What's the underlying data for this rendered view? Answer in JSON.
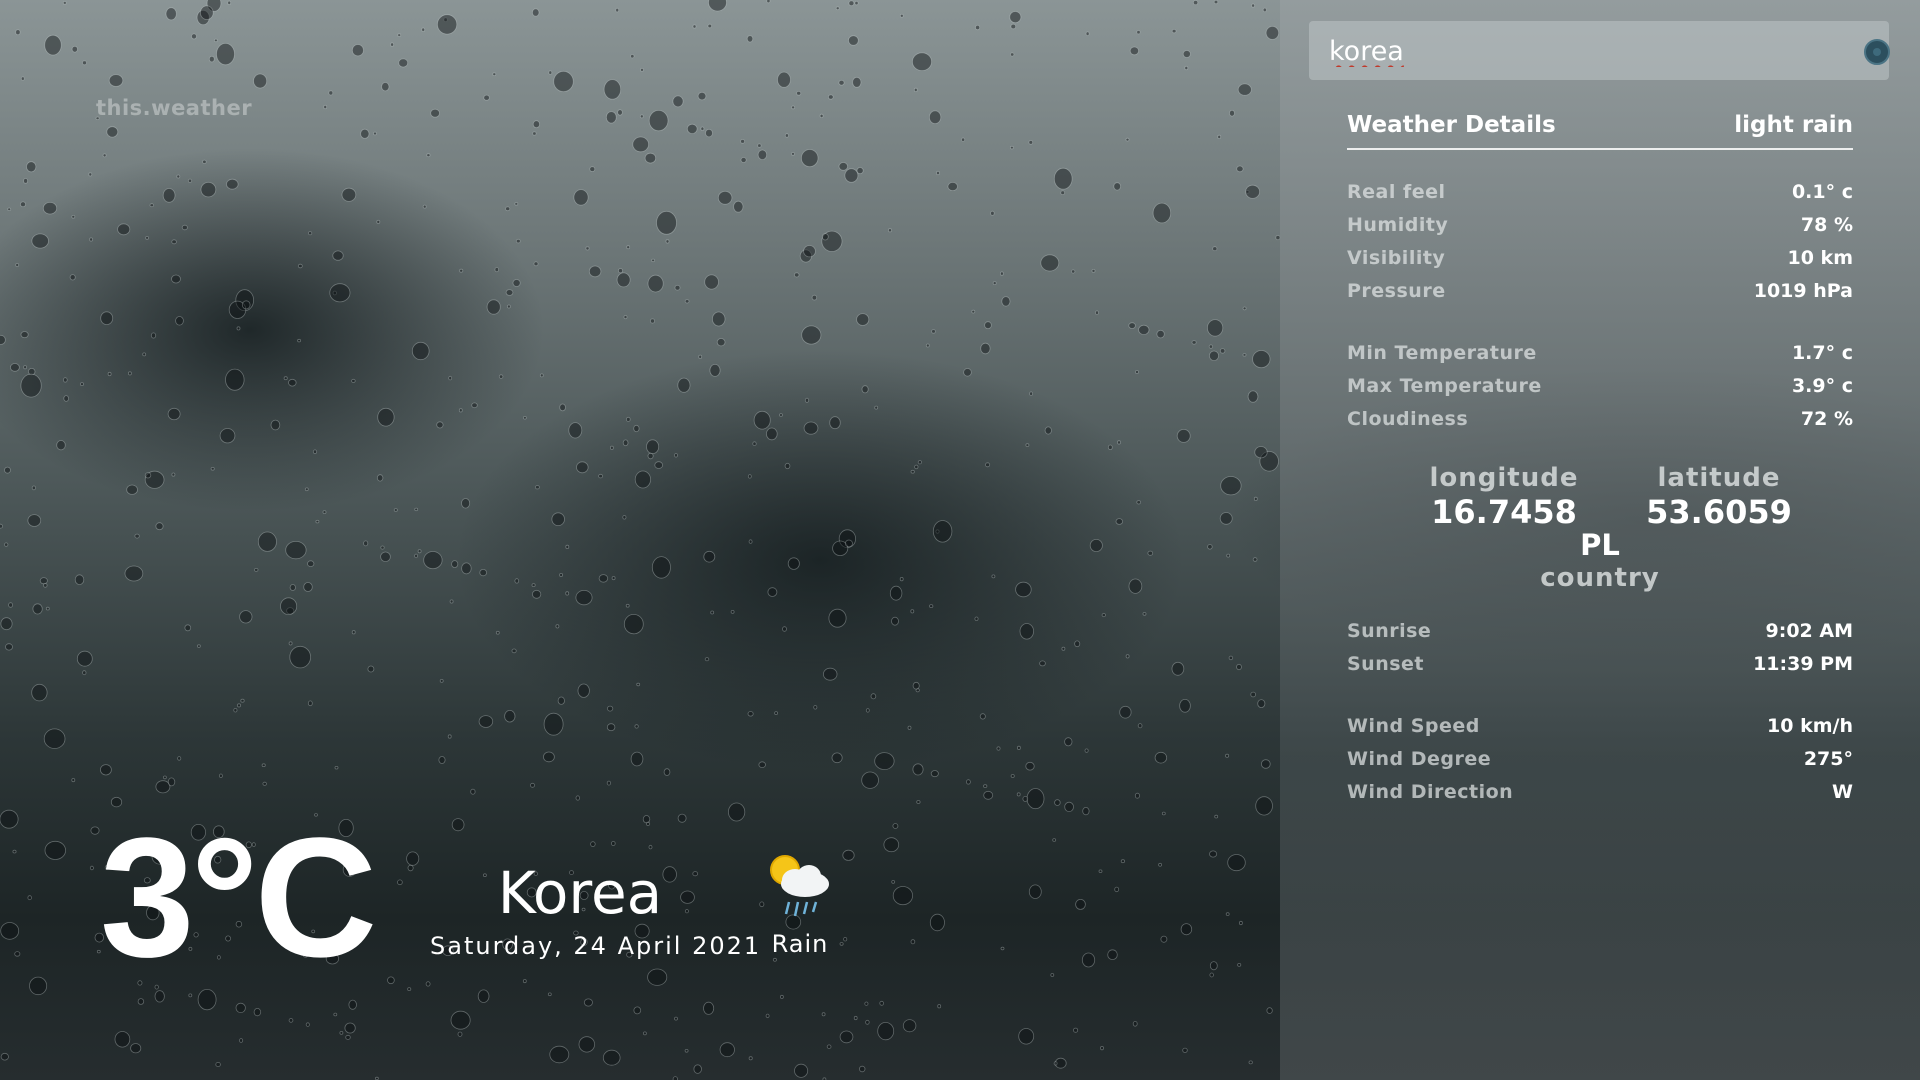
{
  "app": {
    "brand": "this.weather"
  },
  "current": {
    "temperature": "3°C",
    "city": "Korea",
    "date": "Saturday, 24 April 2021",
    "condition": "Rain",
    "condition_icon": "sun-cloud-rain-icon"
  },
  "search": {
    "value": "korea",
    "button_icon": "search-icon"
  },
  "details": {
    "title": "Weather Details",
    "description": "light rain",
    "group1": [
      {
        "label": "Real feel",
        "value": "0.1° c"
      },
      {
        "label": "Humidity",
        "value": "78 %"
      },
      {
        "label": "Visibility",
        "value": "10 km"
      },
      {
        "label": "Pressure",
        "value": "1019 hPa"
      }
    ],
    "group2": [
      {
        "label": "Min Temperature",
        "value": "1.7° c"
      },
      {
        "label": "Max Temperature",
        "value": "3.9° c"
      },
      {
        "label": "Cloudiness",
        "value": "72 %"
      }
    ],
    "coords": {
      "longitude_label": "longitude",
      "longitude": "16.7458",
      "latitude_label": "latitude",
      "latitude": "53.6059",
      "country_code": "PL",
      "country_label": "country"
    },
    "group3": [
      {
        "label": "Sunrise",
        "value": "9:02 AM"
      },
      {
        "label": "Sunset",
        "value": "11:39 PM"
      }
    ],
    "group4": [
      {
        "label": "Wind Speed",
        "value": "10 km/h"
      },
      {
        "label": "Wind Degree",
        "value": "275°"
      },
      {
        "label": "Wind Direction",
        "value": "W"
      }
    ]
  },
  "colors": {
    "accent_button": "#2c4f5e",
    "panel_tint": "#9aa2a4"
  }
}
